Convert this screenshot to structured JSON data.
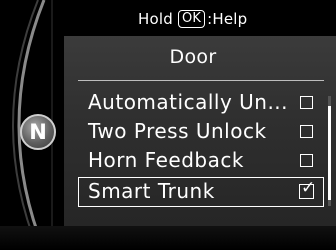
{
  "header": {
    "prefix": "Hold",
    "key_label": "OK",
    "suffix": ":Help"
  },
  "panel": {
    "title": "Door"
  },
  "menu": {
    "items": [
      {
        "label": "Automatically Un...",
        "checked": false
      },
      {
        "label": "Two Press Unlock",
        "checked": false
      },
      {
        "label": "Horn Feedback",
        "checked": false
      },
      {
        "label": "Smart Trunk",
        "checked": true,
        "selected": true
      }
    ]
  },
  "gear": {
    "letter": "N"
  },
  "colors": {
    "text": "#ffffff",
    "panel_bg": "#333333",
    "background": "#000000"
  },
  "icons": {
    "checked": "checkbox-checked-icon",
    "unchecked": "checkbox-unchecked-icon"
  }
}
